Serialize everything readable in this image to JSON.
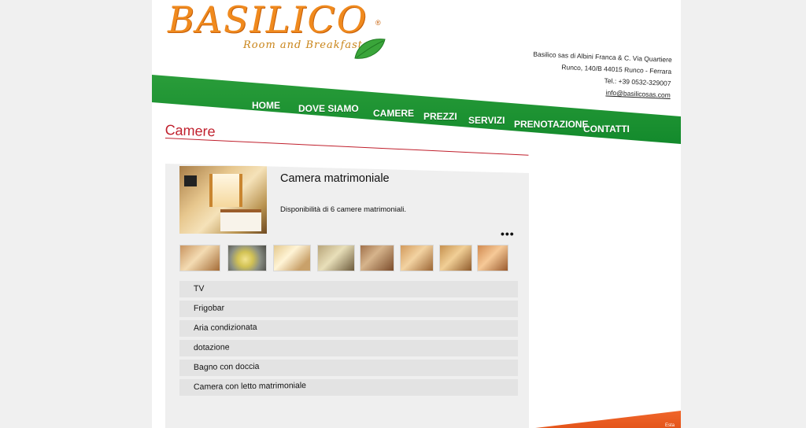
{
  "brand": {
    "logo_main": "BASILICO",
    "logo_sub": "Room and Breakfast",
    "logo_reg": "®"
  },
  "company": {
    "line1": "Basilico sas di Albini Franca & C. Via Quartiere",
    "line2": "Runco, 140/B 44015 Runco - Ferrara",
    "phone": "Tel.: +39 0532-329007",
    "email": "info@basilicosas.com"
  },
  "nav": {
    "items": [
      "HOME",
      "DOVE SIAMO",
      "CAMERE",
      "PREZZI",
      "SERVIZI",
      "PRENOTAZIONE",
      "CONTATTI"
    ]
  },
  "page": {
    "title": "Camere"
  },
  "room": {
    "name": "Camera matrimoniale",
    "description": "Disponibilità di 6 camere matrimoniali.",
    "more": "•••",
    "amenities": [
      "TV",
      "Frigobar",
      "Aria condizionata",
      "dotazione",
      "Bagno con doccia",
      "Camera con letto matrimoniale"
    ]
  },
  "footer": {
    "text": "Esta"
  },
  "colors": {
    "nav_green": "#1f9434",
    "title_red": "#c01f2c",
    "logo_orange": "#f08a1e",
    "footer_orange": "#e85a1c"
  }
}
